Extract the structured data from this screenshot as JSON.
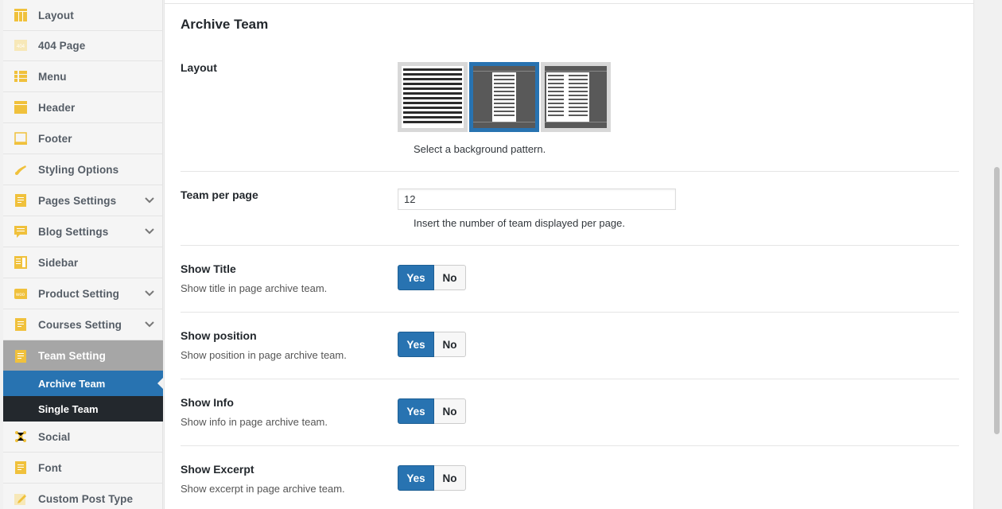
{
  "sidebar": {
    "items": [
      {
        "label": "Layout",
        "icon": "layout-icon"
      },
      {
        "label": "404 Page",
        "icon": "404-icon"
      },
      {
        "label": "Menu",
        "icon": "menu-list-icon"
      },
      {
        "label": "Header",
        "icon": "header-icon"
      },
      {
        "label": "Footer",
        "icon": "footer-icon"
      },
      {
        "label": "Styling Options",
        "icon": "brush-icon"
      },
      {
        "label": "Pages Settings",
        "icon": "pages-icon"
      },
      {
        "label": "Blog Settings",
        "icon": "blog-icon"
      },
      {
        "label": "Sidebar",
        "icon": "sidebar-icon"
      },
      {
        "label": "Product Setting",
        "icon": "woo-icon"
      },
      {
        "label": "Courses Setting",
        "icon": "courses-icon"
      },
      {
        "label": "Team Setting",
        "icon": "team-icon"
      },
      {
        "label": "Social",
        "icon": "social-icon"
      },
      {
        "label": "Font",
        "icon": "font-icon"
      },
      {
        "label": "Custom Post Type",
        "icon": "pencil-icon"
      }
    ],
    "sub_items": [
      {
        "label": "Archive Team"
      },
      {
        "label": "Single Team"
      }
    ]
  },
  "panel": {
    "title": "Archive Team",
    "layout": {
      "label": "Layout",
      "help": "Select a background pattern.",
      "options": [
        "full-width",
        "sidebar-both",
        "sidebar-left"
      ],
      "selected": "sidebar-both"
    },
    "team_per_page": {
      "label": "Team per page",
      "value": "12",
      "help": "Insert the number of team displayed per page."
    },
    "toggles": [
      {
        "label": "Show Title",
        "desc": "Show title in page archive team.",
        "yes": "Yes",
        "no": "No",
        "value": "Yes"
      },
      {
        "label": "Show position",
        "desc": "Show position in page archive team.",
        "yes": "Yes",
        "no": "No",
        "value": "Yes"
      },
      {
        "label": "Show Info",
        "desc": "Show info in page archive team.",
        "yes": "Yes",
        "no": "No",
        "value": "Yes"
      },
      {
        "label": "Show Excerpt",
        "desc": "Show excerpt in page archive team.",
        "yes": "Yes",
        "no": "No",
        "value": "Yes"
      }
    ]
  },
  "colors": {
    "accent": "#2873b1",
    "icon": "#f0c13c",
    "active_parent": "#a6a6a6",
    "dark_sub": "#23282d"
  }
}
